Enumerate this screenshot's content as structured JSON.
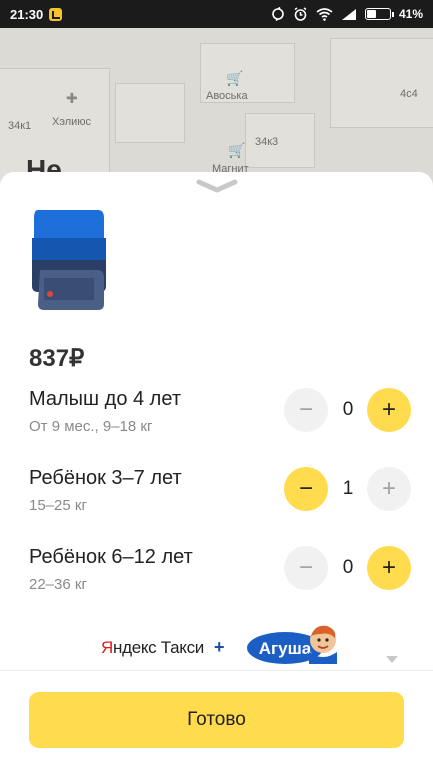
{
  "status_bar": {
    "time": "21:30",
    "battery_text": "41%",
    "battery_level": 0.41,
    "icons": [
      "yandex-app-icon",
      "sync-icon",
      "alarm-icon",
      "wifi-icon",
      "signal-icon",
      "battery-icon"
    ]
  },
  "map": {
    "labels": [
      "Хэлиюс",
      "Авоська",
      "34к1",
      "34к3",
      "Магнит",
      "4с4"
    ]
  },
  "sheet": {
    "title_peek": "Не",
    "price": "837₽",
    "rows": [
      {
        "title": "Малыш до 4 лет",
        "subtitle": "От 9 мес., 9–18 кг",
        "count": "0",
        "minus_active": false,
        "plus_active": true
      },
      {
        "title": "Ребёнок 3–7 лет",
        "subtitle": "15–25 кг",
        "count": "1",
        "minus_active": true,
        "plus_active": false
      },
      {
        "title": "Ребёнок 6–12 лет",
        "subtitle": "22–36 кг",
        "count": "0",
        "minus_active": false,
        "plus_active": true
      }
    ],
    "partner": {
      "yandex_first": "Я",
      "yandex_rest": "ндекс Такси",
      "plus": "+",
      "agusha": "Агуша"
    },
    "done_label": "Готово"
  },
  "colors": {
    "accent": "#ffdb4d",
    "inactive_button": "#f1f1f1",
    "status_bar": "#1b1b1b",
    "seat_blue": "#1e6fd9"
  }
}
